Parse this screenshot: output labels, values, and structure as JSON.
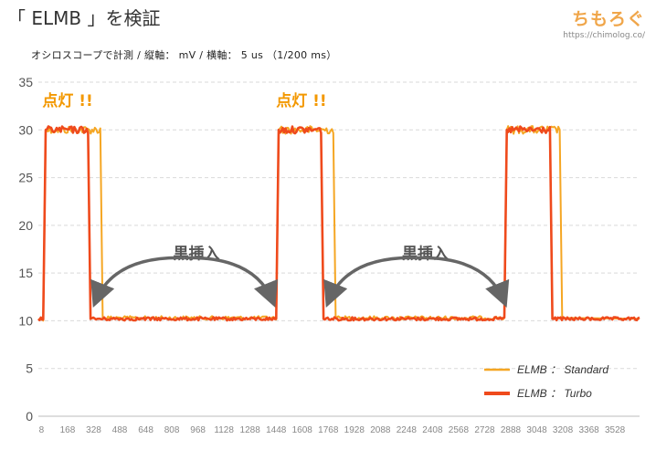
{
  "header": {
    "title": "「 ELMB 」を検証",
    "subtitle": "オシロスコープで計測 / 縦軸： mV / 横軸： 5 us （1/200 ms）",
    "brand_name": "ちもろぐ",
    "brand_url": "https://chimolog.co/"
  },
  "colors": {
    "standard": "#f5a623",
    "turbo": "#ef4a1c",
    "annotation": "#f39800",
    "arrow": "#666666",
    "grid": "#d9d9d9"
  },
  "chart_data": {
    "type": "line",
    "title": "「 ELMB 」を検証",
    "subtitle": "オシロスコープで計測 / 縦軸： mV / 横軸： 5 us （1/200 ms）",
    "xlabel": "",
    "ylabel": "",
    "xlim": [
      0,
      3690
    ],
    "ylim": [
      0,
      35
    ],
    "yticks": [
      0,
      5,
      10,
      15,
      20,
      25,
      30,
      35
    ],
    "xticks": [
      8,
      168,
      328,
      488,
      648,
      808,
      968,
      1128,
      1288,
      1448,
      1608,
      1768,
      1928,
      2088,
      2248,
      2408,
      2568,
      2728,
      2888,
      3048,
      3208,
      3368,
      3528
    ],
    "grid": "horizontal dashed",
    "legend_position": "bottom-right",
    "series": [
      {
        "name": "ELMB ： Standard",
        "color": "#f5a623",
        "points": [
          [
            0,
            10.2
          ],
          [
            30,
            10.2
          ],
          [
            45,
            30
          ],
          [
            380,
            30
          ],
          [
            395,
            10.3
          ],
          [
            1460,
            10.3
          ],
          [
            1475,
            30
          ],
          [
            1810,
            30
          ],
          [
            1825,
            10.3
          ],
          [
            2860,
            10.3
          ],
          [
            2875,
            30
          ],
          [
            3200,
            30
          ],
          [
            3215,
            10.3
          ],
          [
            3690,
            10.2
          ]
        ]
      },
      {
        "name": "ELMB ： Turbo",
        "color": "#ef4a1c",
        "points": [
          [
            0,
            10.2
          ],
          [
            30,
            10.2
          ],
          [
            45,
            30
          ],
          [
            305,
            30
          ],
          [
            320,
            10.2
          ],
          [
            1460,
            10.2
          ],
          [
            1475,
            30
          ],
          [
            1735,
            30
          ],
          [
            1750,
            10.2
          ],
          [
            2860,
            10.2
          ],
          [
            2875,
            30
          ],
          [
            3140,
            30
          ],
          [
            3155,
            10.2
          ],
          [
            3690,
            10.2
          ]
        ]
      }
    ],
    "annotations": [
      {
        "text": "点灯 !!",
        "x": 180,
        "y": 32.5
      },
      {
        "text": "点灯 !!",
        "x": 1615,
        "y": 32.5
      },
      {
        "text": "黒挿入",
        "x": 970,
        "y": 16.5
      },
      {
        "text": "黒挿入",
        "x": 2375,
        "y": 16.5
      }
    ],
    "arrows": [
      {
        "from": [
          350,
          12
        ],
        "to": [
          1440,
          12
        ]
      },
      {
        "from": [
          1780,
          12
        ],
        "to": [
          2860,
          12
        ]
      }
    ]
  }
}
